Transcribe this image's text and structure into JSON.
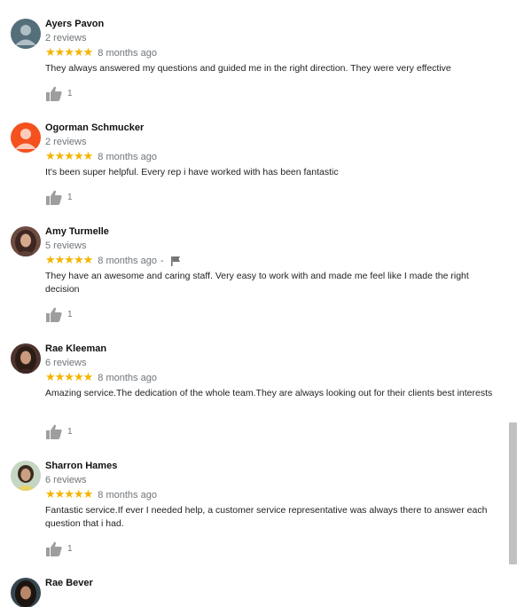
{
  "reviews": [
    {
      "name": "Ayers Pavon",
      "count": "2 reviews",
      "stars": "★★★★★",
      "time": "8 months ago",
      "text": "They always answered my questions and guided me in the right direction. They were very effective",
      "likes": "1"
    },
    {
      "name": "Ogorman Schmucker",
      "count": "2 reviews",
      "stars": "★★★★★",
      "time": "8 months ago",
      "text": "It's been super helpful. Every rep i have worked with has been fantastic",
      "likes": "1"
    },
    {
      "name": "Amy Turmelle",
      "count": "5 reviews",
      "stars": "★★★★★",
      "time": "8 months ago",
      "separator": "-",
      "text": "They have an awesome and caring staff. Very easy to work with and made me feel like I made the right decision",
      "likes": "1"
    },
    {
      "name": "Rae Kleeman",
      "count": "6 reviews",
      "stars": "★★★★★",
      "time": "8 months ago",
      "text": "Amazing service.The dedication of the whole team.They are always looking out for their clients best interests",
      "likes": "1"
    },
    {
      "name": "Sharron Hames",
      "count": "6 reviews",
      "stars": "★★★★★",
      "time": "8 months ago",
      "text": "Fantastic service.If ever I needed help, a customer service representative was always there to answer each question that i had.",
      "likes": "1"
    },
    {
      "name": "Rae Bever"
    }
  ],
  "colors": {
    "star": "#f4b400",
    "avatar_ayers": "#546e7a",
    "avatar_ogorman": "#f4511e"
  },
  "icons": {
    "like": "thumb-up-icon",
    "flag": "flag-icon"
  }
}
